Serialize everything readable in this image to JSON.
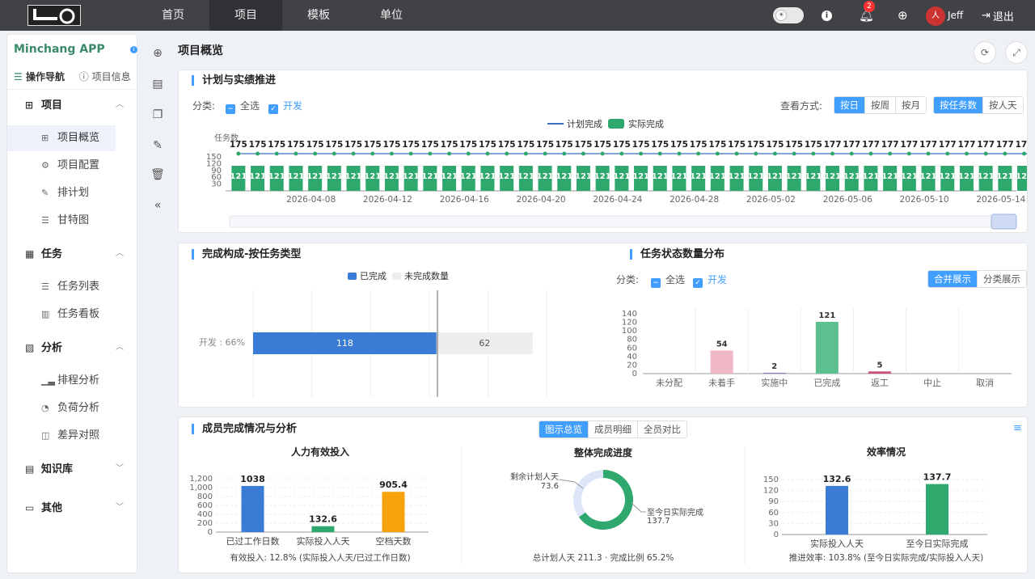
{
  "topnav": {
    "tabs": [
      "首页",
      "项目",
      "模板",
      "单位"
    ],
    "user": "Jeff",
    "logout": "退出",
    "notif_count": "2"
  },
  "sidebar": {
    "app_name": "Minchang APP",
    "tabs": {
      "nav": "操作导航",
      "info": "项目信息"
    },
    "groups": {
      "project": "项目",
      "task": "任务",
      "analysis": "分析",
      "kb": "知识库",
      "other": "其他"
    },
    "items": {
      "overview": "项目概览",
      "config": "项目配置",
      "schedule": "排计划",
      "gantt": "甘特图",
      "task_list": "任务列表",
      "task_board": "任务看板",
      "sched_analysis": "排程分析",
      "load_analysis": "负荷分析",
      "diff_compare": "差异对照"
    }
  },
  "page": {
    "title": "项目概览"
  },
  "panel1": {
    "title": "计划与实绩推进",
    "cat_label": "分类:",
    "select_all": "全选",
    "dev": "开发",
    "view_label": "查看方式:",
    "granularity": [
      "按日",
      "按周",
      "按月"
    ],
    "measure": [
      "按任务数",
      "按人天"
    ],
    "legend_plan": "计划完成",
    "legend_actual": "实际完成",
    "y_axis_name": "任务数"
  },
  "panel2": {
    "title": "完成构成-按任务类型",
    "legend_done": "已完成",
    "legend_undone": "未完成数量",
    "row_label": "开发 : 66%"
  },
  "panel3": {
    "title": "任务状态数量分布",
    "cat_label": "分类:",
    "select_all": "全选",
    "dev": "开发",
    "modes": [
      "合并展示",
      "分类展示"
    ]
  },
  "panel4": {
    "title": "成员完成情况与分析",
    "tabs": [
      "图示总览",
      "成员明细",
      "全员对比"
    ],
    "sub1": {
      "title": "人力有效投入",
      "footer": "有效投入: 12.8% (实际投入人天/已过工作日数)"
    },
    "sub2": {
      "title": "整体完成进度",
      "footer": "总计划人天 211.3 · 完成比例 65.2%",
      "remain_label": "剩余计划人天",
      "remain_value": "73.6",
      "done_label": "至今日实际完成",
      "done_value": "137.7"
    },
    "sub3": {
      "title": "效率情况",
      "footer": "推进效率: 103.8% (至今日实际完成/实际投入人天)"
    }
  },
  "chart_data": [
    {
      "type": "bar+line",
      "series": [
        {
          "name": "计划完成",
          "type": "line",
          "values": [
            175,
            175,
            175,
            175,
            175,
            175,
            175,
            175,
            175,
            175,
            175,
            175,
            175,
            175,
            175,
            175,
            175,
            175,
            175,
            175,
            175,
            175,
            175,
            175,
            175,
            175,
            175,
            175,
            175,
            175,
            175,
            177,
            177,
            177,
            177,
            177,
            177,
            177,
            177,
            177,
            177,
            177,
            177
          ]
        },
        {
          "name": "实际完成",
          "type": "bar",
          "values": [
            121,
            121,
            121,
            121,
            121,
            121,
            121,
            121,
            121,
            121,
            121,
            121,
            121,
            121,
            121,
            121,
            121,
            121,
            121,
            121,
            121,
            121,
            121,
            121,
            121,
            121,
            121,
            121,
            121,
            121,
            121,
            121,
            121,
            121,
            121,
            121,
            121,
            121,
            121,
            121,
            121,
            121,
            121
          ]
        }
      ],
      "x_ticks": [
        "2026-04-08",
        "2026-04-12",
        "2026-04-16",
        "2026-04-20",
        "2026-04-24",
        "2026-04-28",
        "2026-05-02",
        "2026-05-06",
        "2026-05-10",
        "2026-05-14"
      ],
      "y_ticks": [
        150,
        120,
        90,
        60,
        30
      ],
      "ylabel": "任务数"
    },
    {
      "type": "bar",
      "orientation": "horizontal",
      "stacked": true,
      "categories": [
        "开发 : 66%"
      ],
      "series": [
        {
          "name": "已完成",
          "values": [
            118
          ],
          "color": "#3a7bd5"
        },
        {
          "name": "未完成数量",
          "values": [
            62
          ],
          "color": "#eeeeee"
        }
      ]
    },
    {
      "type": "bar",
      "categories": [
        "未分配",
        "未着手",
        "实施中",
        "已完成",
        "返工",
        "中止",
        "取消"
      ],
      "values": [
        0,
        54,
        2,
        121,
        5,
        0,
        0
      ],
      "colors": [
        "#cccccc",
        "#f0b8c4",
        "#8e7cc3",
        "#5cbf8e",
        "#cc4f79",
        "#cccccc",
        "#cccccc"
      ],
      "ylim": [
        0,
        140
      ],
      "y_ticks": [
        140,
        120,
        100,
        80,
        60,
        40,
        20,
        0
      ]
    },
    {
      "type": "bar",
      "title": "人力有效投入",
      "categories": [
        "已过工作日数",
        "实际投入人天",
        "空档天数"
      ],
      "values": [
        1038,
        132.6,
        905.4
      ],
      "colors": [
        "#3a7bd5",
        "#2fa86e",
        "#f5a20d"
      ],
      "ylim": [
        0,
        1200
      ],
      "y_ticks": [
        "1,200",
        "1,000",
        "800",
        "600",
        "400",
        "200",
        "0"
      ]
    },
    {
      "type": "pie",
      "donut": true,
      "title": "整体完成进度",
      "slices": [
        {
          "name": "至今日实际完成",
          "value": 137.7,
          "color": "#2fa86e"
        },
        {
          "name": "剩余计划人天",
          "value": 73.6,
          "color": "#dde6f8"
        }
      ]
    },
    {
      "type": "bar",
      "title": "效率情况",
      "categories": [
        "实际投入人天",
        "至今日实际完成"
      ],
      "values": [
        132.6,
        137.7
      ],
      "colors": [
        "#3a7bd5",
        "#2fa86e"
      ],
      "ylim": [
        0,
        150
      ],
      "y_ticks": [
        150,
        120,
        90,
        60,
        30,
        0
      ]
    }
  ]
}
